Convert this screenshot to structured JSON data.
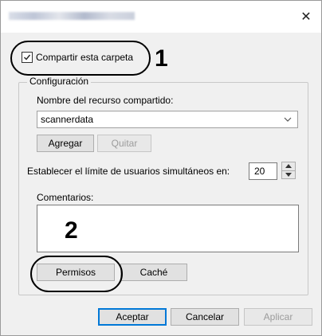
{
  "window": {
    "close_glyph": "✕"
  },
  "share": {
    "checkbox_label": "Compartir esta carpeta",
    "checked": true,
    "callout_number": "1"
  },
  "config": {
    "group_label": "Configuración",
    "share_name_label": "Nombre del recurso compartido:",
    "share_name_value": "scannerdata",
    "add_button": "Agregar",
    "remove_button": "Quitar",
    "user_limit_label": "Establecer el límite de usuarios simultáneos en:",
    "user_limit_value": "20",
    "comments_label": "Comentarios:",
    "comments_value": "",
    "comments_callout_number": "2",
    "permissions_button": "Permisos",
    "cache_button": "Caché"
  },
  "footer": {
    "ok_button": "Aceptar",
    "cancel_button": "Cancelar",
    "apply_button": "Aplicar"
  },
  "colors": {
    "dialog_bg": "#f0f0f0",
    "default_button_border": "#0078d7",
    "disabled_text": "#9c9c9c"
  }
}
